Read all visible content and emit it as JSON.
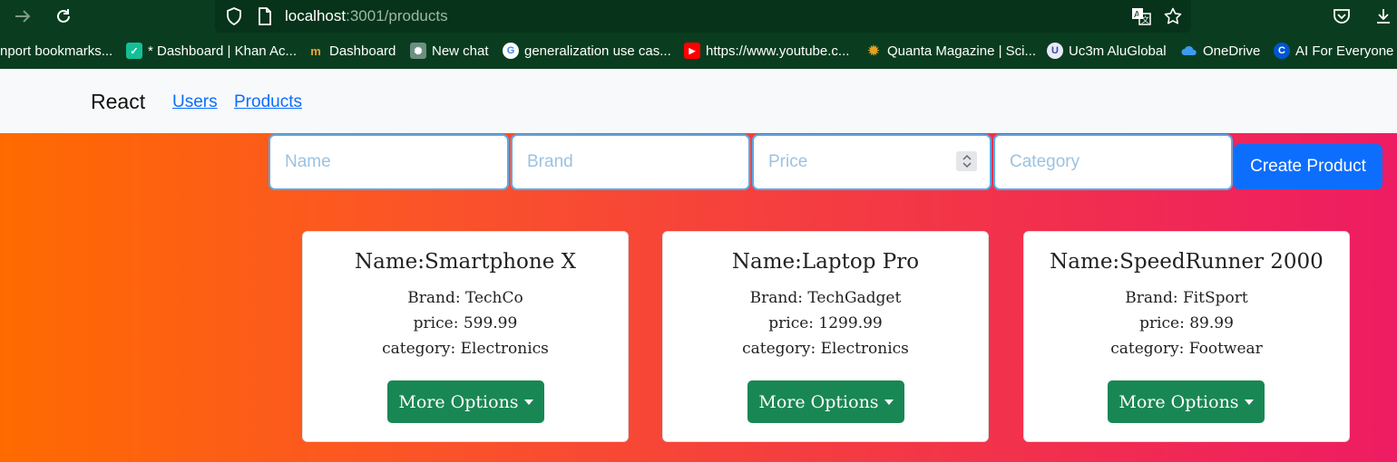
{
  "browser": {
    "url_host": "localhost",
    "url_path": ":3001/products",
    "bookmarks": [
      {
        "label": "nport bookmarks...",
        "icon": "none"
      },
      {
        "label": "* Dashboard | Khan Ac...",
        "icon": "khan-academy-icon"
      },
      {
        "label": "Dashboard",
        "icon": "dashboard-icon"
      },
      {
        "label": "New chat",
        "icon": "chatgpt-icon"
      },
      {
        "label": "generalization use cas...",
        "icon": "google-icon"
      },
      {
        "label": "https://www.youtube.c...",
        "icon": "youtube-icon"
      },
      {
        "label": "Quanta Magazine | Sci...",
        "icon": "quanta-icon"
      },
      {
        "label": "Uc3m AluGlobal",
        "icon": "uc3m-icon"
      },
      {
        "label": "OneDrive",
        "icon": "onedrive-icon"
      },
      {
        "label": "AI For Everyone -",
        "icon": "coursera-icon"
      }
    ]
  },
  "navbar": {
    "brand": "React",
    "links": [
      "Users",
      "Products"
    ]
  },
  "form": {
    "name_placeholder": "Name",
    "brand_placeholder": "Brand",
    "price_placeholder": "Price",
    "category_placeholder": "Category",
    "submit_label": "Create Product"
  },
  "products": [
    {
      "title": "Name:Smartphone X",
      "brand": "Brand: TechCo",
      "price": "price: 599.99",
      "category": "category: Electronics",
      "button": "More Options"
    },
    {
      "title": "Name:Laptop Pro",
      "brand": "Brand: TechGadget",
      "price": "price: 1299.99",
      "category": "category: Electronics",
      "button": "More Options"
    },
    {
      "title": "Name:SpeedRunner 2000",
      "brand": "Brand: FitSport",
      "price": "price: 89.99",
      "category": "category: Footwear",
      "button": "More Options"
    }
  ],
  "colors": {
    "gradient_start": "#ff6a00",
    "gradient_end": "#ee1c62",
    "primary": "#0d6efd",
    "success": "#198754",
    "browser_chrome": "#0a3d1f"
  }
}
